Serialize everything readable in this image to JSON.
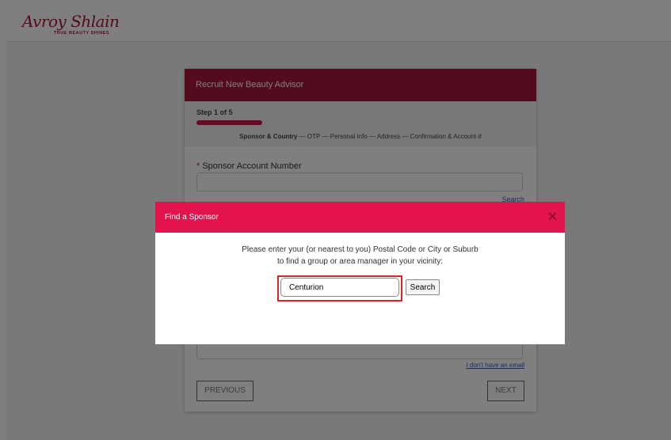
{
  "brand": {
    "name": "Avroy Shlain",
    "tagline": "TRUE BEAUTY SHINES"
  },
  "card": {
    "title": "Recruit New Beauty Advisor",
    "step_label": "Step 1 of 5",
    "progress": 0.2,
    "steps_active": "Sponsor & Country",
    "steps_rest": " — OTP — Personal Info — Address — Confirmation & Account #",
    "sponsor_label": "Sponsor Account Number",
    "required_mark": "*",
    "search_link": "Search",
    "no_email_link": "I don't have an email",
    "previous_button": "PREVIOUS",
    "next_button": "NEXT"
  },
  "dialog": {
    "title": "Find a Sponsor",
    "close_glyph": "✕",
    "instruction_line1": "Please enter your (or nearest to you) Postal Code or City or Suburb",
    "instruction_line2": "to find a group or area manager in your vicinity:",
    "input_value": "Centurion",
    "search_button": "Search"
  },
  "colors": {
    "brand": "#a8163c",
    "dialog_header": "#e3134b",
    "highlight": "#e0202a",
    "link": "#2a62c8"
  }
}
